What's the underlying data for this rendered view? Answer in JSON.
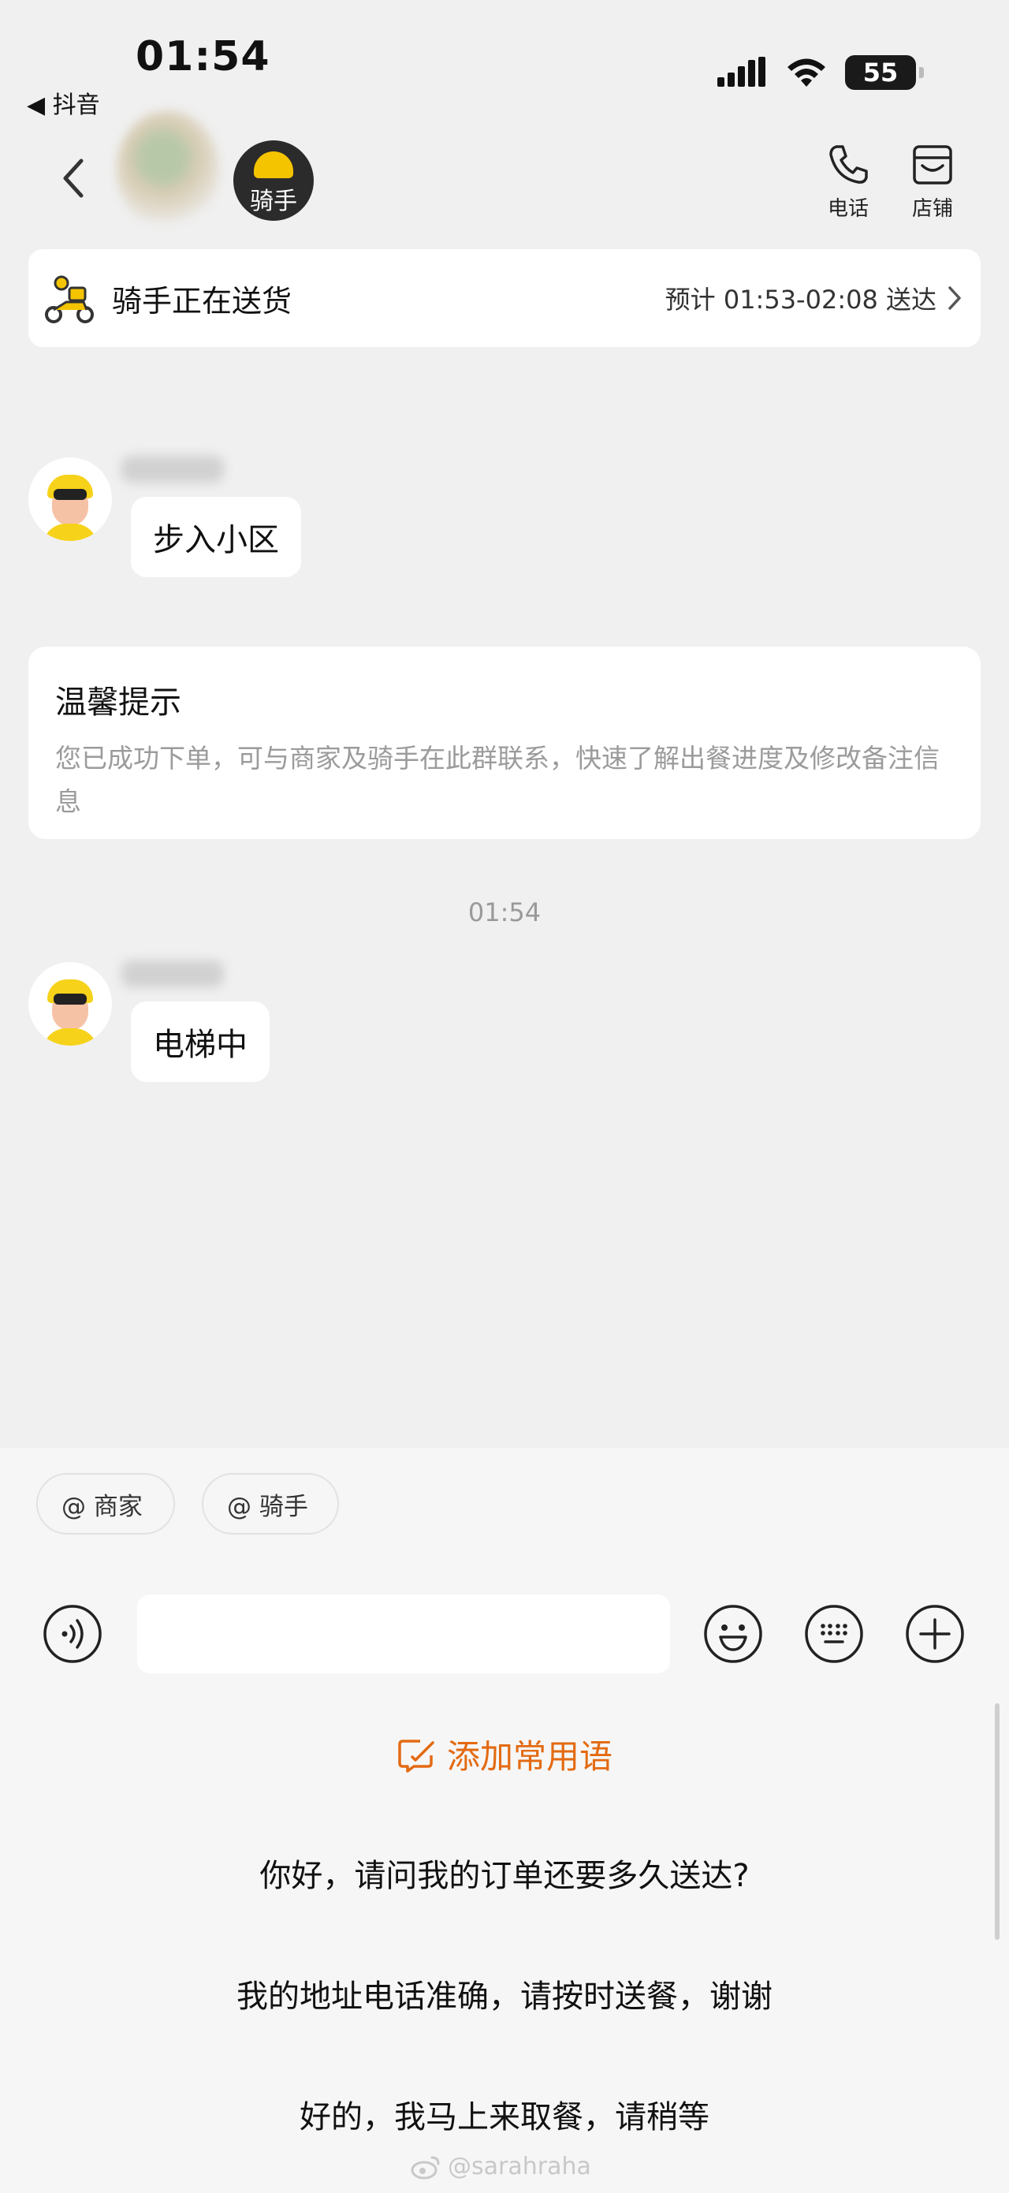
{
  "status_bar": {
    "time": "01:54",
    "back_app": "◀ 抖音",
    "battery": "55"
  },
  "header": {
    "rider_label": "骑手",
    "actions": [
      {
        "label": "电话",
        "icon": "phone-icon"
      },
      {
        "label": "店铺",
        "icon": "store-icon"
      }
    ]
  },
  "delivery": {
    "title": "骑手正在送货",
    "eta": "预计 01:53-02:08 送达"
  },
  "messages": [
    {
      "text": "步入小区"
    },
    {
      "text": "电梯中"
    }
  ],
  "tip": {
    "title": "温馨提示",
    "body": "您已成功下单，可与商家及骑手在此群联系，快速了解出餐进度及修改备注信息"
  },
  "timestamp": "01:54",
  "mentions": {
    "merchant": "@ 商家",
    "rider": "@ 骑手"
  },
  "input": {
    "value": "",
    "placeholder": ""
  },
  "quick_replies": {
    "add_label": "添加常用语",
    "phrases": [
      "你好，请问我的订单还要多久送达?",
      "我的地址电话准确，请按时送餐，谢谢",
      "好的，我马上来取餐，请稍等"
    ]
  },
  "watermark": "@sarahraha",
  "colors": {
    "accent": "#e36a12",
    "background": "#f0f0f0",
    "bubble": "#ffffff",
    "rider_yellow": "#f6d21a"
  }
}
